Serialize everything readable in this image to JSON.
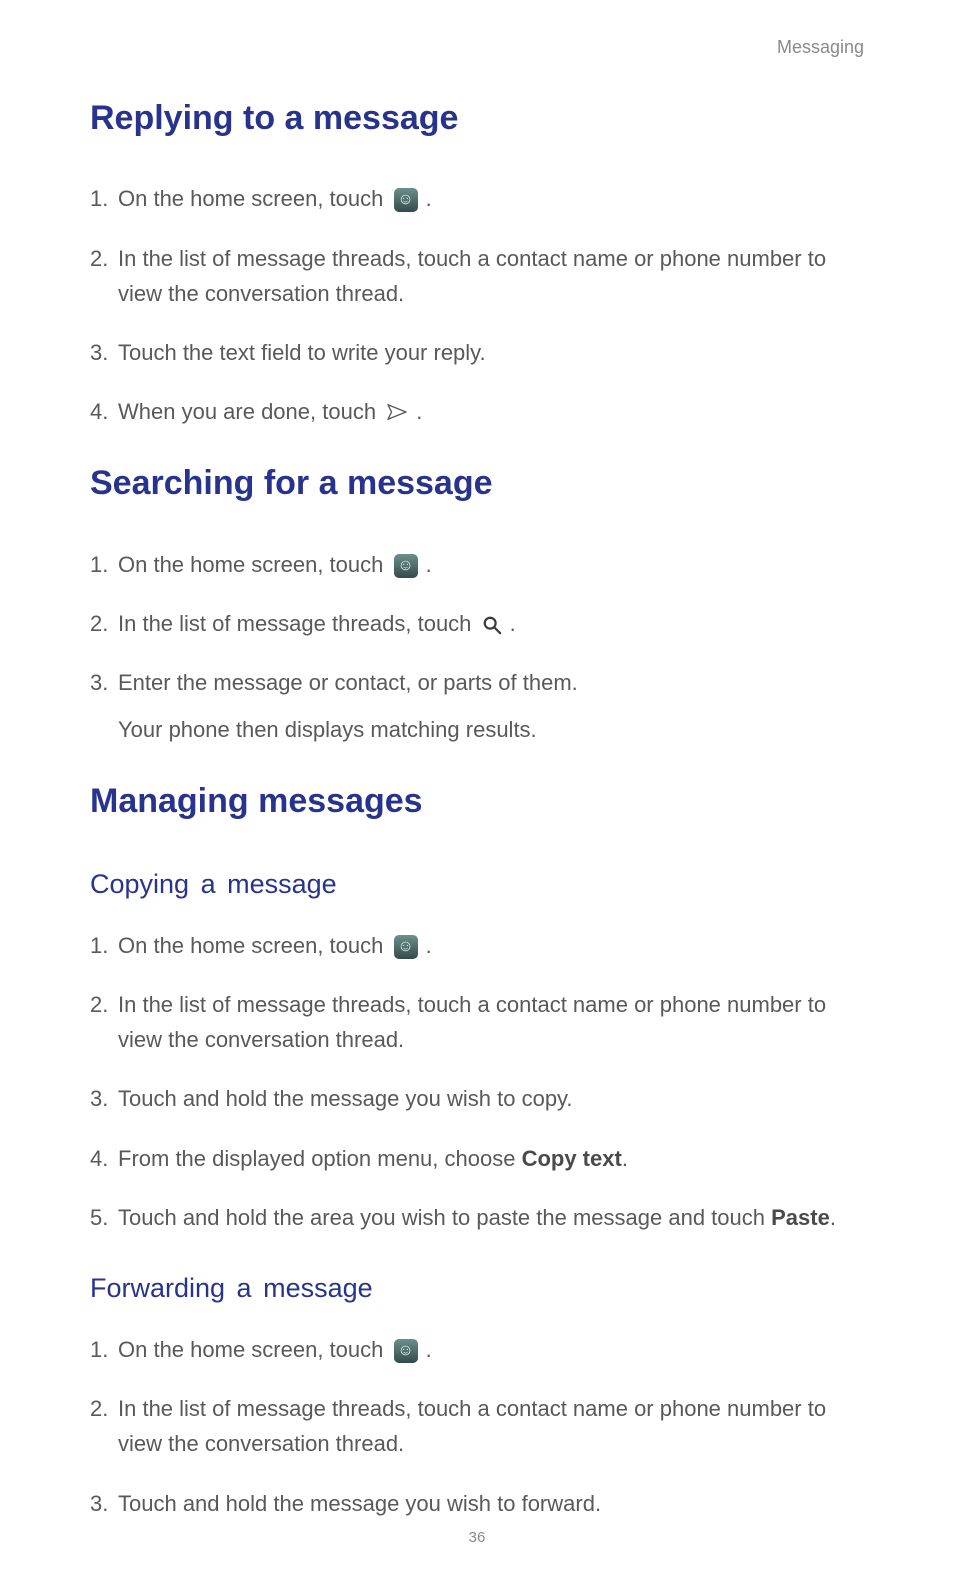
{
  "header": {
    "section_label": "Messaging"
  },
  "replying": {
    "title": "Replying to a message",
    "steps": [
      {
        "pre": "On the home screen, touch ",
        "post": " ."
      },
      {
        "pre": "In the list of message threads, touch a contact name or phone number to view the conversation thread."
      },
      {
        "pre": "Touch the text field to write your reply."
      },
      {
        "pre": "When you are done, touch ",
        "post": " ."
      }
    ]
  },
  "searching": {
    "title": "Searching for a message",
    "steps": [
      {
        "pre": "On the home screen, touch ",
        "post": " ."
      },
      {
        "pre": "In the list of message threads, touch ",
        "post": " ."
      },
      {
        "pre": "Enter the message or contact, or parts of them.",
        "extra": "Your phone then displays matching results."
      }
    ]
  },
  "managing": {
    "title": "Managing messages",
    "copying": {
      "title": "Copying a message",
      "steps": [
        {
          "pre": "On the home screen, touch ",
          "post": " ."
        },
        {
          "pre": "In the list of message threads, touch a contact name or phone number to view the conversation thread."
        },
        {
          "pre": "Touch and hold the message you wish to copy."
        },
        {
          "pre": "From the displayed option menu, choose ",
          "bold": "Copy text",
          "post": "."
        },
        {
          "pre": "Touch and hold the area you wish to paste the message and touch ",
          "bold": "Paste",
          "post": "."
        }
      ]
    },
    "forwarding": {
      "title": "Forwarding a message",
      "steps": [
        {
          "pre": "On the home screen, touch ",
          "post": " ."
        },
        {
          "pre": "In the list of message threads, touch a contact name or phone number to view the conversation thread."
        },
        {
          "pre": "Touch and hold the message you wish to forward."
        }
      ]
    }
  },
  "page_number": "36"
}
